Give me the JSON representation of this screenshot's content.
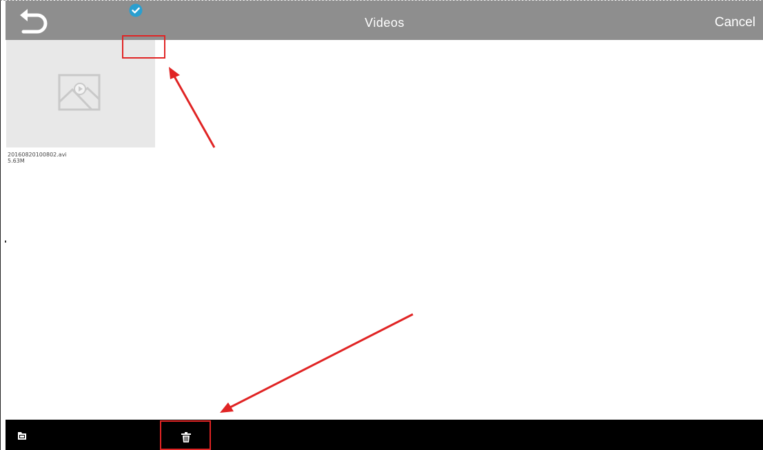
{
  "app": {
    "title": "Videos",
    "cancel_label": "Cancel"
  },
  "icons": {
    "back": "back-arrow-icon",
    "selected": "check-circle-icon",
    "placeholder": "image-placeholder-icon",
    "folder": "folder-icon",
    "trash": "trash-icon"
  },
  "videos": [
    {
      "name": "20160820100802.avi",
      "size": "5.63M",
      "selected": true
    }
  ],
  "colors": {
    "topbar": "#8e8e8e",
    "bottombar": "#000000",
    "check": "#2a9fd0",
    "annotation": "#e02424"
  }
}
